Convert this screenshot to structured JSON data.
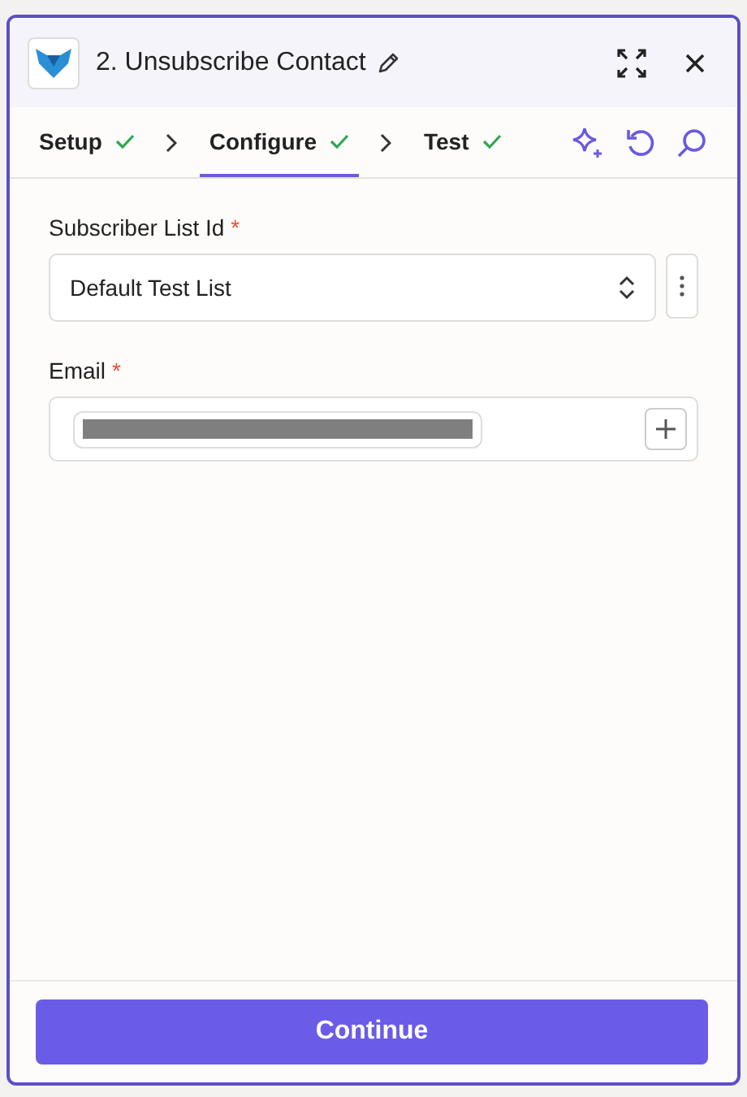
{
  "header": {
    "title": "2. Unsubscribe Contact"
  },
  "tabs": [
    {
      "label": "Setup",
      "done": true,
      "selected": false
    },
    {
      "label": "Configure",
      "done": true,
      "selected": true
    },
    {
      "label": "Test",
      "done": true,
      "selected": false
    }
  ],
  "fields": [
    {
      "kind": "select",
      "label": "Subscriber List Id",
      "required_mark": "*",
      "value": "Default Test List"
    },
    {
      "kind": "chips",
      "label": "Email",
      "required_mark": "*",
      "redacted": true
    }
  ],
  "footer": {
    "button": "Continue"
  }
}
